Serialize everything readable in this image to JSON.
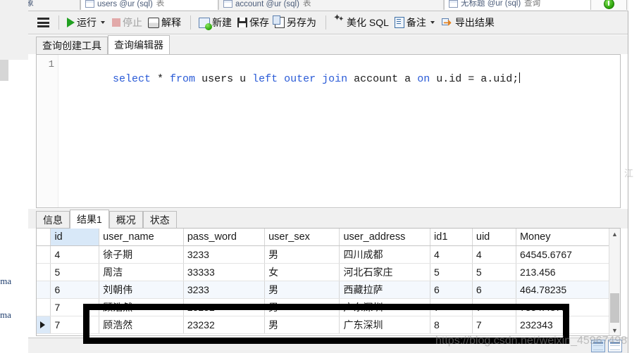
{
  "window": {
    "document_tabs": [
      {
        "label": "对象",
        "type": "",
        "icon": ""
      },
      {
        "label": "users @ur (sql)",
        "type": "表",
        "icon": "table-icon"
      },
      {
        "label": "account @ur (sql)",
        "type": "表",
        "icon": "table-icon"
      },
      {
        "label": "无标题 @ur (sql)",
        "type": "查询",
        "icon": "query-icon"
      }
    ],
    "top_right_button": "status-indicator"
  },
  "toolbar": {
    "menu_icon": "hamburger-menu-icon",
    "items": [
      {
        "label": "运行",
        "icon": "run-icon",
        "has_caret": true,
        "disabled": false
      },
      {
        "label": "停止",
        "icon": "stop-icon",
        "has_caret": false,
        "disabled": true
      },
      {
        "label": "解释",
        "icon": "explain-icon",
        "has_caret": false,
        "disabled": false
      },
      {
        "label": "新建",
        "icon": "new-icon",
        "has_caret": false,
        "disabled": false
      },
      {
        "label": "保存",
        "icon": "save-icon",
        "has_caret": false,
        "disabled": false
      },
      {
        "label": "另存为",
        "icon": "save-as-icon",
        "has_caret": false,
        "disabled": false
      },
      {
        "label": "美化 SQL",
        "icon": "beautify-icon",
        "has_caret": false,
        "disabled": false
      },
      {
        "label": "备注",
        "icon": "note-icon",
        "has_caret": true,
        "disabled": false
      },
      {
        "label": "导出结果",
        "icon": "export-icon",
        "has_caret": false,
        "disabled": false
      }
    ]
  },
  "editor_tabs": [
    {
      "label": "查询创建工具",
      "active": false
    },
    {
      "label": "查询编辑器",
      "active": true
    }
  ],
  "editor": {
    "line_number": "1",
    "tokens": [
      {
        "text": "select",
        "kw": true
      },
      {
        "text": " * ",
        "kw": false
      },
      {
        "text": "from",
        "kw": true
      },
      {
        "text": " users u ",
        "kw": false
      },
      {
        "text": "left",
        "kw": true
      },
      {
        "text": " ",
        "kw": false
      },
      {
        "text": "outer",
        "kw": true
      },
      {
        "text": " ",
        "kw": false
      },
      {
        "text": "join",
        "kw": true
      },
      {
        "text": " account a ",
        "kw": false
      },
      {
        "text": "on",
        "kw": true
      },
      {
        "text": " u.id = a.uid;",
        "kw": false
      }
    ],
    "full_text": "select * from users u left outer join account a on u.id = a.uid;"
  },
  "result_tabs": [
    {
      "label": "信息",
      "active": false
    },
    {
      "label": "结果1",
      "active": true
    },
    {
      "label": "概况",
      "active": false
    },
    {
      "label": "状态",
      "active": false
    }
  ],
  "grid": {
    "columns": [
      "id",
      "user_name",
      "pass_word",
      "user_sex",
      "user_address",
      "id1",
      "uid",
      "Money"
    ],
    "selected_column": "id",
    "rows": [
      {
        "id": "4",
        "user_name": "徐子期",
        "pass_word": "3233",
        "user_sex": "男",
        "user_address": "四川成都",
        "id1": "4",
        "uid": "4",
        "Money": "64545.6767"
      },
      {
        "id": "5",
        "user_name": "周洁",
        "pass_word": "33333",
        "user_sex": "女",
        "user_address": "河北石家庄",
        "id1": "5",
        "uid": "5",
        "Money": "213.456"
      },
      {
        "id": "6",
        "user_name": "刘朝伟",
        "pass_word": "3233",
        "user_sex": "男",
        "user_address": "西藏拉萨",
        "id1": "6",
        "uid": "6",
        "Money": "464.78235"
      },
      {
        "id": "7",
        "user_name": "顾浩然",
        "pass_word": "23232",
        "user_sex": "男",
        "user_address": "广东深圳",
        "id1": "7",
        "uid": "7",
        "Money": "7354.4879"
      },
      {
        "id": "7",
        "user_name": "顾浩然",
        "pass_word": "23232",
        "user_sex": "男",
        "user_address": "广东深圳",
        "id1": "8",
        "uid": "7",
        "Money": "232343"
      }
    ],
    "current_row_index": 4,
    "highlight_box": "black-rectangle-annotation"
  },
  "sidebar_fragments": [
    "hema",
    "chema"
  ],
  "watermark": {
    "main": "https://blog.csdn.net/weixin_45967498",
    "side": "江"
  },
  "colors": {
    "keyword": "#2a5bd7",
    "toolbar_bg": "#f0f0f0",
    "selected_header": "#d8e8f8",
    "alt_row": "#f4f8fd",
    "annotation": "#000000"
  }
}
